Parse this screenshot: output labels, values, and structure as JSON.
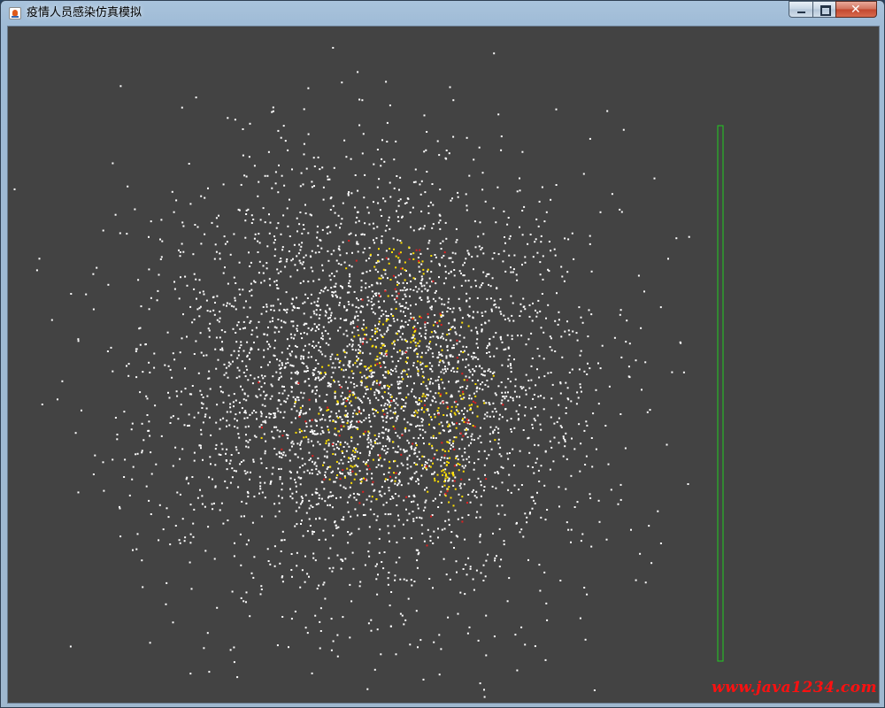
{
  "window": {
    "title": "疫情人员感染仿真模拟",
    "buttons": {
      "minimize": "minimize",
      "maximize": "maximize",
      "close": "close"
    }
  },
  "simulation": {
    "colors": {
      "background": "#434343",
      "healthy": "#ffffff",
      "infected": "#ffe000",
      "confirmed": "#e02020",
      "hospital_border": "#22cc22"
    },
    "population": {
      "white_dots": 3600,
      "yellow_dots": 330,
      "red_dots": 110
    }
  },
  "watermark": "www.java1234.com"
}
